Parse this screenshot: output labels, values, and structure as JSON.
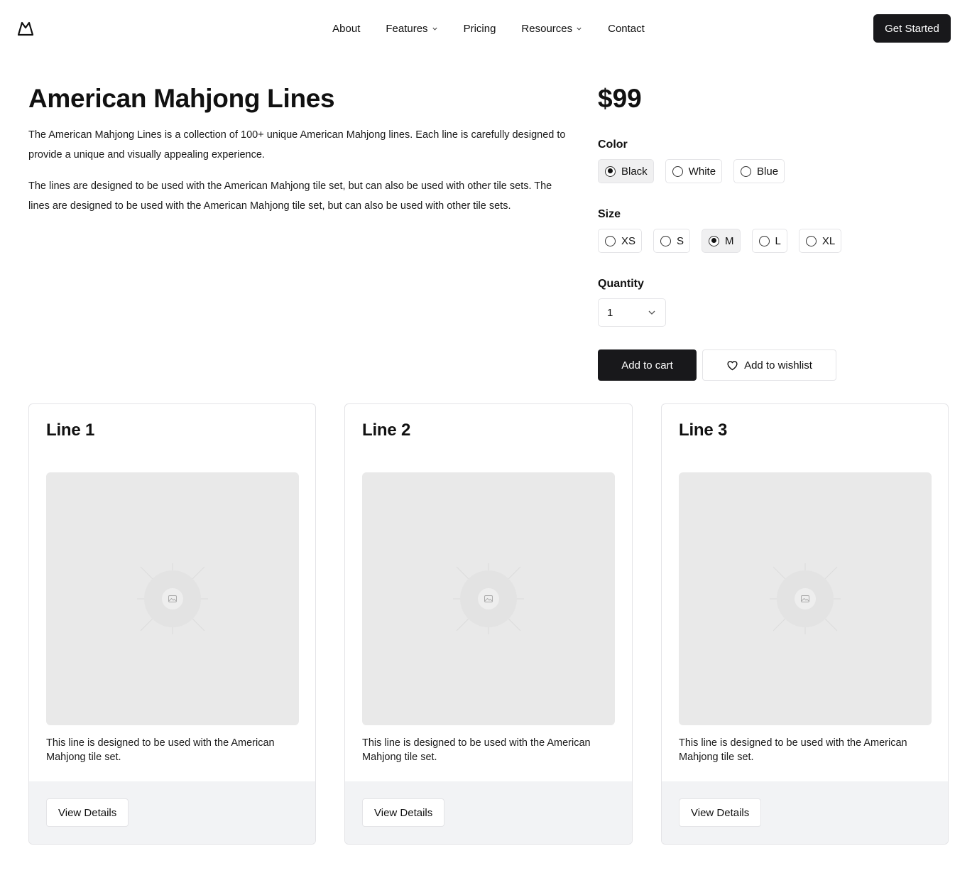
{
  "nav": {
    "items": [
      {
        "label": "About",
        "has_dropdown": false
      },
      {
        "label": "Features",
        "has_dropdown": true
      },
      {
        "label": "Pricing",
        "has_dropdown": false
      },
      {
        "label": "Resources",
        "has_dropdown": true
      },
      {
        "label": "Contact",
        "has_dropdown": false
      }
    ],
    "cta_label": "Get Started"
  },
  "product": {
    "title": "American Mahjong Lines",
    "description_1": "The American Mahjong Lines is a collection of 100+ unique American Mahjong lines. Each line is carefully designed to provide a unique and visually appealing experience.",
    "description_2": "The lines are designed to be used with the American Mahjong tile set, but can also be used with other tile sets. The lines are designed to be used with the American Mahjong tile set, but can also be used with other tile sets.",
    "price": "$99"
  },
  "options": {
    "color_label": "Color",
    "colors": [
      {
        "label": "Black",
        "selected": true
      },
      {
        "label": "White",
        "selected": false
      },
      {
        "label": "Blue",
        "selected": false
      }
    ],
    "size_label": "Size",
    "sizes": [
      {
        "label": "XS",
        "selected": false
      },
      {
        "label": "S",
        "selected": false
      },
      {
        "label": "M",
        "selected": true
      },
      {
        "label": "L",
        "selected": false
      },
      {
        "label": "XL",
        "selected": false
      }
    ],
    "quantity_label": "Quantity",
    "quantity_value": "1"
  },
  "actions": {
    "add_to_cart": "Add to cart",
    "add_to_wishlist": "Add to wishlist"
  },
  "cards": [
    {
      "title": "Line 1",
      "description": "This line is designed to be used with the American Mahjong tile set.",
      "button": "View Details"
    },
    {
      "title": "Line 2",
      "description": "This line is designed to be used with the American Mahjong tile set.",
      "button": "View Details"
    },
    {
      "title": "Line 3",
      "description": "This line is designed to be used with the American Mahjong tile set.",
      "button": "View Details"
    }
  ],
  "icons": {
    "logo": "mountain-logo-icon",
    "dropdown": "chevron-down-icon",
    "wishlist": "heart-icon",
    "image_placeholder": "image-placeholder-icon"
  },
  "colors": {
    "primary_button": "#18181b",
    "border": "#e4e4e7",
    "image_placeholder_bg": "#e9e9e9",
    "card_footer_bg": "#f2f3f5",
    "selected_option_bg": "#f0f0f1"
  }
}
